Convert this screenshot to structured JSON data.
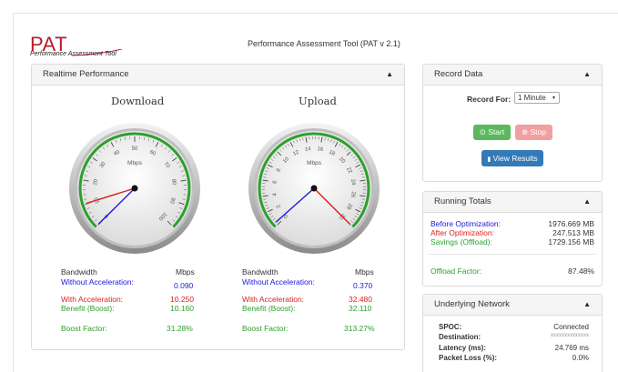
{
  "header": {
    "logo_text": "PAT",
    "logo_sub": "Performance Assessment Tool",
    "title": "Performance Assessment Tool (PAT v 2.1)"
  },
  "realtime": {
    "title": "Realtime Performance",
    "download": {
      "title": "Download",
      "unit": "Mbps",
      "ticks": [
        "0",
        "10",
        "20",
        "30",
        "40",
        "50",
        "60",
        "70",
        "80",
        "90",
        "100"
      ],
      "max": 100,
      "value_without": 0.09,
      "value_with": 10.25,
      "value_benefit": 10.16,
      "hdr_left": "Bandwidth",
      "hdr_right": "Mbps",
      "without_label": "Without Acceleration:",
      "without_value": "0.090",
      "with_label": "With Acceleration:",
      "with_value": "10.250",
      "benefit_label": "Benefit (Boost):",
      "benefit_value": "10.160",
      "boost_label": "Boost Factor:",
      "boost_value": "31.28%"
    },
    "upload": {
      "title": "Upload",
      "unit": "Mbps",
      "ticks": [
        "0",
        "2",
        "4",
        "6",
        "8",
        "10",
        "12",
        "14",
        "16",
        "18",
        "20",
        "22",
        "24",
        "26",
        "28",
        "30"
      ],
      "max": 30,
      "value_without": 0.37,
      "value_with": 32.48,
      "value_benefit": 32.11,
      "hdr_left": "Bandwidth",
      "hdr_right": "Mbps",
      "without_label": "Without Acceleration:",
      "without_value": "0.370",
      "with_label": "With Acceleration:",
      "with_value": "32.480",
      "benefit_label": "Benefit (Boost):",
      "benefit_value": "32.110",
      "boost_label": "Boost Factor:",
      "boost_value": "313.27%"
    }
  },
  "record": {
    "title": "Record Data",
    "for_label": "Record For:",
    "selected": "1 Minute",
    "start_label": "Start",
    "stop_label": "Stop",
    "results_label": "View Results"
  },
  "totals": {
    "title": "Running Totals",
    "before_label": "Before Optimization:",
    "before_value": "1976.669 MB",
    "after_label": "After Optimization:",
    "after_value": "247.513 MB",
    "savings_label": "Savings (Offload):",
    "savings_value": "1729.156 MB",
    "offload_label": "Offload Factor:",
    "offload_value": "87.48%"
  },
  "network": {
    "title": "Underlying Network",
    "spoc_label": "SPOC:",
    "spoc_value": "Connected",
    "dest_label": "Destination:",
    "dest_value": "xxxxxxxxxxxxxx",
    "latency_label": "Latency (ms):",
    "latency_value": "24.769 ms",
    "loss_label": "Packet Loss (%):",
    "loss_value": "0.0%"
  },
  "colors": {
    "without": "#1a1adb",
    "with": "#e02020",
    "benefit": "#8fd08f",
    "arc": "#2ca02c"
  }
}
